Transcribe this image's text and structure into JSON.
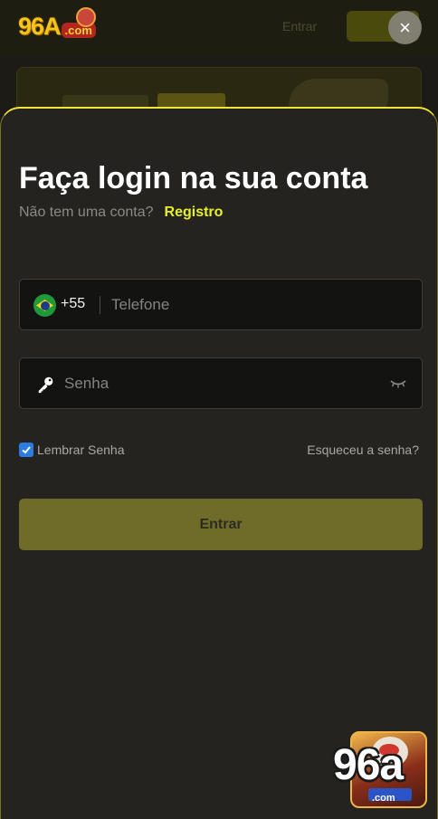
{
  "background": {
    "logo": {
      "number": "96A",
      "domain": ".com"
    },
    "entrar_label": "Entrar"
  },
  "close_glyph": "×",
  "login": {
    "title": "Faça login na sua conta",
    "no_account_text": "Não tem uma conta?",
    "register_link": "Registro",
    "phone": {
      "country_code": "+55",
      "placeholder": "Telefone",
      "flag": "brazil-flag-icon"
    },
    "password": {
      "placeholder": "Senha",
      "icon": "key-icon",
      "toggle_icon": "eye-closed-icon"
    },
    "remember_label": "Lembrar Senha",
    "remember_checked": true,
    "forgot_link": "Esqueceu a senha?",
    "submit_label": "Entrar"
  },
  "floating_badge": {
    "number": "96a",
    "domain": ".com"
  },
  "colors": {
    "accent": "#e8f02a",
    "button": "#6f6c2a",
    "sheet": "#24231f",
    "checkbox": "#2b7de1"
  }
}
